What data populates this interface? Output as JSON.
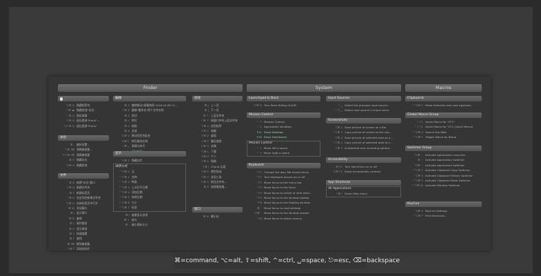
{
  "headers": {
    "finder": "Finder",
    "system": "System",
    "macros": "Macros"
  },
  "legend": "⌘=command, ⌥=alt, ⇧=shift, ^=ctrl, ␣=space, ⎋=esc, ⌫=backspace",
  "finder_col1": {
    "sec_apple": "",
    "apple": [
      {
        "k": "⌥⌘ D",
        "t": "隐藏程序坞"
      },
      {
        "k": "^⌘ ⏏",
        "t": "隐藏其他\"访达\""
      },
      {
        "k": "^⌘ Q",
        "t": "锁定屏幕"
      },
      {
        "k": "⇧⌘ Q",
        "t": "退出登录\"Frank\"..."
      },
      {
        "k": "⌥⇧⌘ Q",
        "t": "退出登录\"Frank\""
      }
    ],
    "sec_finder": "访达",
    "finder": [
      {
        "k": "⌘ ,",
        "t": "偏好设置..."
      },
      {
        "k": "⇧⌘ ⌫",
        "t": "清倒废纸篓..."
      },
      {
        "k": "⌥⇧⌘ ⌫",
        "t": "清倒废纸篓"
      },
      {
        "k": "⌘ H",
        "t": "隐藏访达"
      },
      {
        "k": "⌥⌘ H",
        "t": "隐藏其他"
      }
    ],
    "sec_file": "文件",
    "file": [
      {
        "k": "⌘ N",
        "t": "新建\"访达\"窗口"
      },
      {
        "k": "⇧⌘ N",
        "t": "新建文件夹"
      },
      {
        "k": "⌘ T",
        "t": "新建标签页"
      },
      {
        "k": "^⌘ N",
        "t": "包含项目新建文件夹"
      },
      {
        "k": "⌥⌘ O",
        "t": "在新标签页中打开"
      },
      {
        "k": "⌘ W",
        "t": "关闭窗口"
      },
      {
        "k": "⌘ I",
        "t": "显示简介"
      },
      {
        "k": "⌘ D",
        "t": "复制"
      },
      {
        "k": "⌘ L",
        "t": "制作替身"
      },
      {
        "k": "⌘ R",
        "t": "显示原身"
      },
      {
        "k": "⌘ Y",
        "t": "快速查看"
      },
      {
        "k": "⌘ F",
        "t": "查找"
      },
      {
        "k": "⌘ ⌫",
        "t": "移到废纸篓"
      },
      {
        "k": "^⌘ T",
        "t": "添加到边栏"
      }
    ]
  },
  "finder_col2": {
    "sec_edit": "编辑",
    "edit": [
      {
        "k": "⌘ Z",
        "t": "撤销移动\"屏幕快照 2018-10-08 11..."
      },
      {
        "k": "⇧⌘ Z",
        "t": "重做\"重命名\"两个文件名称"
      },
      {
        "k": "⌘ X",
        "t": "剪切"
      },
      {
        "k": "⌘ C",
        "t": "拷贝"
      },
      {
        "k": "⌘ V",
        "t": "粘贴"
      },
      {
        "k": "⌘ A",
        "t": "全选"
      },
      {
        "k": "⌥⌘ V",
        "t": "移动项目到此处"
      },
      {
        "k": "⌥⌘ C",
        "t": "拷贝路径名称"
      },
      {
        "k": "^⌘ ␣",
        "t": "表情与符号"
      }
    ],
    "edit_hl": [
      {
        "k": "fn fn",
        "t": "开始听写..."
      }
    ],
    "sec_view": "显示",
    "view": [
      {
        "k": "⌥⌘ S",
        "t": "隐藏边栏"
      }
    ],
    "sub_sort": "排序方式",
    "sort": [
      {
        "k": "^⌥⌘ 0",
        "t": "无"
      },
      {
        "k": "^⌥⌘ 1",
        "t": "名称"
      },
      {
        "k": "^⌥⌘ 2",
        "t": "种类"
      },
      {
        "k": "^⌥⌘ 3",
        "t": "上次打开日期"
      },
      {
        "k": "^⌥⌘ 4",
        "t": "添加日期"
      },
      {
        "k": "^⌥⌘ 5",
        "t": "修改日期"
      },
      {
        "k": "^⌥⌘ 6",
        "t": "大小"
      },
      {
        "k": "^⌥⌘ 7",
        "t": "标签"
      }
    ],
    "view2": [
      {
        "k": "⌘ J",
        "t": "查看显示选项"
      },
      {
        "k": "⌘ +",
        "t": "放大"
      },
      {
        "k": "⌘ -",
        "t": "缩小图标大小"
      }
    ]
  },
  "finder_col3": {
    "sec_go": "前往",
    "go": [
      {
        "k": "⌘ [",
        "t": "上一页"
      },
      {
        "k": "⌘ ]",
        "t": "下一页"
      },
      {
        "k": "⌘ ↑",
        "t": "上层文件夹"
      },
      {
        "k": "^⌘ ↑",
        "t": "新窗口中的上层文件夹"
      },
      {
        "k": "⇧⌘ A",
        "t": "应用程序"
      },
      {
        "k": "⇧⌘ C",
        "t": "电脑"
      },
      {
        "k": "⇧⌘ D",
        "t": "桌面"
      },
      {
        "k": "⇧⌘ F",
        "t": "最近使用"
      },
      {
        "k": "⇧⌘ O",
        "t": "文稿"
      },
      {
        "k": "⌥⌘ L",
        "t": "下载"
      },
      {
        "k": "⇧⌘ H",
        "t": "个人"
      },
      {
        "k": "⇧⌘ K",
        "t": "网络"
      },
      {
        "k": "⇧⌘ I",
        "t": "iCloud 云盘"
      },
      {
        "k": "⇧⌘ R",
        "t": "隔空投送"
      },
      {
        "k": "⇧⌘ U",
        "t": "实用工具"
      },
      {
        "k": "⇧⌘ G",
        "t": "前往文件夹..."
      },
      {
        "k": "⌘ K",
        "t": "连接服务器..."
      }
    ],
    "sec_window": "窗口",
    "window": [
      {
        "k": "⌘ M",
        "t": "最小化"
      }
    ]
  },
  "system_col1": {
    "sec_launch": "Launchpad & Dock",
    "launch": [
      {
        "k": "⌥⌘ D",
        "t": "Turn Dock Hiding On/Off"
      }
    ],
    "sec_mc": "Mission Control",
    "mc": [
      {
        "k": "^ ↑",
        "t": "Mission Control"
      },
      {
        "k": "^ ↓",
        "t": "Application windows"
      }
    ],
    "mc_hl": [
      {
        "k": "F11",
        "t": "Show Desktop"
      },
      {
        "k": "F12",
        "t": "Show Dashboard"
      }
    ],
    "sub_mc": "Mission Control",
    "mc2": [
      {
        "k": "^ ←",
        "t": "Move left a space"
      },
      {
        "k": "^ →",
        "t": "Move right a space"
      }
    ],
    "sec_kb": "Keyboard",
    "kb": [
      {
        "k": "^F7",
        "t": "Change the way Tab moves focus"
      },
      {
        "k": "^F1",
        "t": "Turn keyboard access on or off"
      },
      {
        "k": "^F2",
        "t": "Move focus to the menu bar"
      },
      {
        "k": "^F3",
        "t": "Move focus to the Dock"
      },
      {
        "k": "^F4",
        "t": "Move focus to active or next wind..."
      },
      {
        "k": "^F5",
        "t": "Move focus to the window toolbar"
      },
      {
        "k": "^F6",
        "t": "Move focus to the floating window"
      },
      {
        "k": "⌘ `",
        "t": "Move focus to next window"
      },
      {
        "k": "⌥⌘ `",
        "t": "Move focus to the window drawer"
      },
      {
        "k": "^F8",
        "t": "Move focus to status menus"
      }
    ]
  },
  "system_col2": {
    "sec_input": "Input Sources",
    "input": [
      {
        "k": "^ ␣",
        "t": "Select the previous input source"
      },
      {
        "k": "^⌥ ␣",
        "t": "Select next source in Input menu"
      }
    ],
    "sec_shot": "Screenshots",
    "shot": [
      {
        "k": "⇧⌘ 3",
        "t": "Save picture of screen as a file"
      },
      {
        "k": "^⇧⌘ 3",
        "t": "Copy picture of screen to the clip..."
      },
      {
        "k": "⇧⌘ 4",
        "t": "Save picture of selected area as a..."
      },
      {
        "k": "^⇧⌘ 4",
        "t": "Copy picture of selected area to t..."
      },
      {
        "k": "⇧⌘ 5",
        "t": "Screenshot and recording options"
      }
    ],
    "sec_access": "Accessibility",
    "access": [
      {
        "k": "⌘ F5",
        "t": "Turn VoiceOver on or off"
      },
      {
        "k": "⌥⌘ F5",
        "t": "Show Accessibility controls"
      }
    ],
    "sec_app": "App Shortcuts",
    "sub_app": "All Applications",
    "app": [
      {
        "k": "⇧⌘ /",
        "t": "Show Help menu"
      }
    ]
  },
  "macros_col": {
    "sec_clip": "Clipboards",
    "clip": [
      {
        "k": "^⌥⌘ C",
        "t": "Paste Selection into Last Applicati..."
      }
    ],
    "sec_global": "Global Macro Group",
    "global": [
      {
        "k": "^ F1",
        "t": "Quick Macro for \"CF1\""
      },
      {
        "k": "^⇧ F1",
        "t": "Quick Macro for \"CF1 (Quick Macro)"
      },
      {
        "k": "^⌥⌘ G",
        "t": "Search the Web"
      },
      {
        "k": "^⌥⌘ T",
        "t": "Trigger Macro by Name"
      }
    ],
    "sec_switch": "Switcher Group",
    "switch": [
      {
        "k": "⌥⌘ ~",
        "t": "Activate Application Launcher"
      },
      {
        "k": "⌘ ~",
        "t": "Activate Application Switcher"
      },
      {
        "k": "⌥⌘ ~",
        "t": "Activate Application Switcher"
      },
      {
        "k": "^⌥⌘ C",
        "t": "Activate Clipboard Copy Switcher"
      },
      {
        "k": "⌥⌘ V",
        "t": "Activate Clipboard History Switcher"
      },
      {
        "k": "^⌥⌘ V",
        "t": "Activate Clipboard Paste Switcher"
      },
      {
        "k": "^⌥⌘ W",
        "t": "Activate Window Switcher"
      }
    ],
    "sec_kc": "KeyCue",
    "kc": [
      {
        "k": "⌥⌘ K",
        "t": "KeyCue Settings"
      },
      {
        "k": "^⌥⌘ F",
        "t": "Find Shortcuts..."
      }
    ]
  }
}
